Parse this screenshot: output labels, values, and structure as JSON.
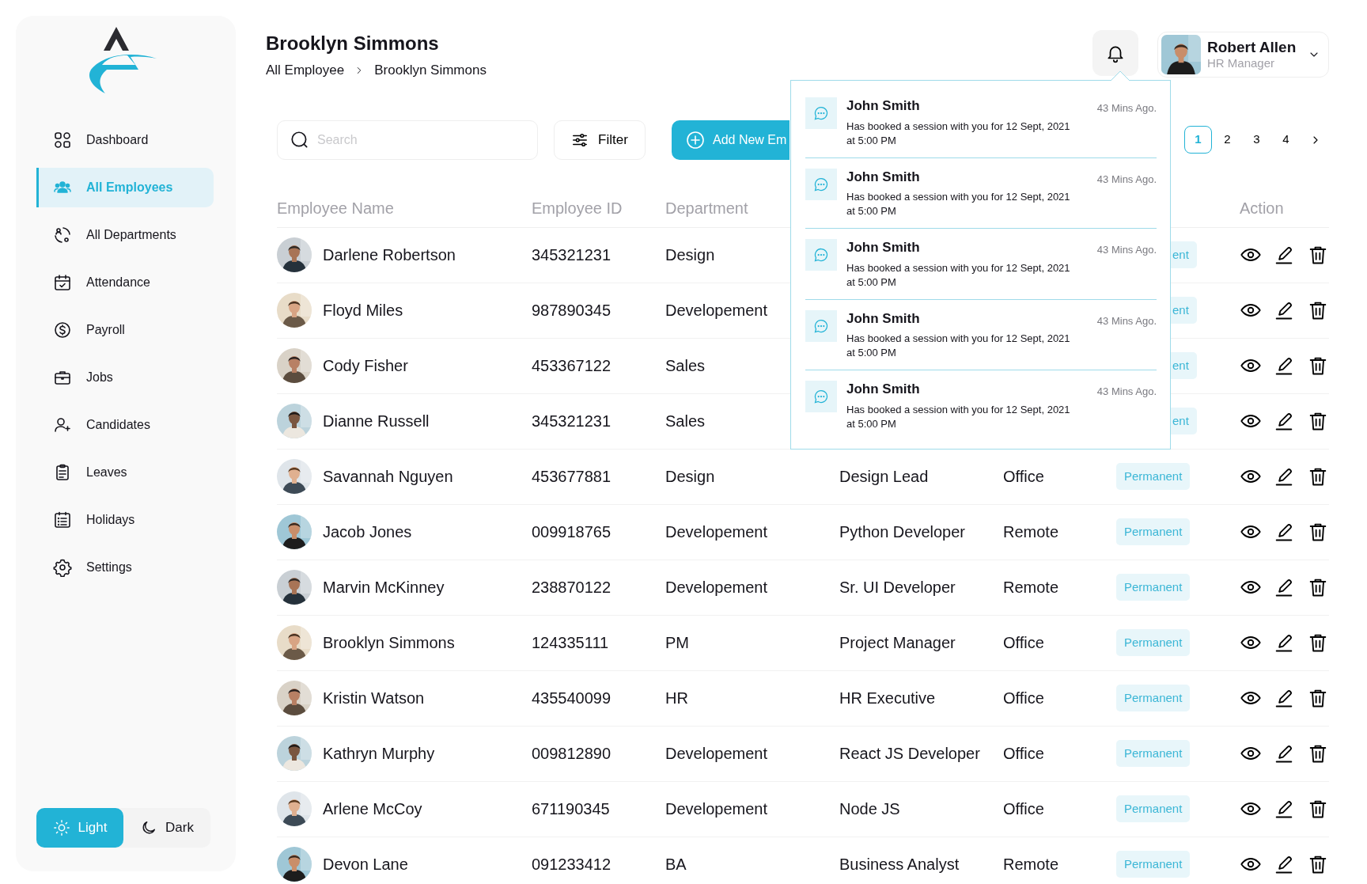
{
  "sidebar": {
    "items": [
      {
        "label": "Dashboard",
        "selected": false
      },
      {
        "label": "All Employees",
        "selected": true
      },
      {
        "label": "All Departments",
        "selected": false
      },
      {
        "label": "Attendance",
        "selected": false
      },
      {
        "label": "Payroll",
        "selected": false
      },
      {
        "label": "Jobs",
        "selected": false
      },
      {
        "label": "Candidates",
        "selected": false
      },
      {
        "label": "Leaves",
        "selected": false
      },
      {
        "label": "Holidays",
        "selected": false
      },
      {
        "label": "Settings",
        "selected": false
      }
    ],
    "theme": [
      {
        "label": "Light",
        "selected": true
      },
      {
        "label": "Dark",
        "selected": false
      }
    ]
  },
  "header": {
    "title": "Brooklyn Simmons",
    "breadcrumb": [
      "All Employee",
      "Brooklyn Simmons"
    ],
    "user": {
      "name": "Robert Allen",
      "role": "HR Manager"
    }
  },
  "toolbar": {
    "search": {
      "placeholder": "Search"
    },
    "filter": "Filter",
    "add_button": "Add New Em",
    "pages": [
      {
        "label": "1",
        "selected": true
      },
      {
        "label": "2",
        "selected": false
      },
      {
        "label": "3",
        "selected": false
      },
      {
        "label": "4",
        "selected": false
      }
    ]
  },
  "table": {
    "columns": {
      "name": "Employee Name",
      "employee_id": "Employee ID",
      "department": "Department",
      "action": "Action"
    },
    "rows": [
      {
        "name": "Darlene Robertson",
        "employee_id": "345321231",
        "department": "Design",
        "status": "ent"
      },
      {
        "name": "Floyd Miles",
        "employee_id": "987890345",
        "department": "Developement",
        "status": "ent"
      },
      {
        "name": "Cody Fisher",
        "employee_id": "453367122",
        "department": "Sales",
        "status": "ent"
      },
      {
        "name": "Dianne Russell",
        "employee_id": "345321231",
        "department": "Sales",
        "status": "ent"
      },
      {
        "name": "Savannah Nguyen",
        "employee_id": "453677881",
        "department": "Design",
        "designation": "Design Lead",
        "type": "Office",
        "status": "Permanent"
      },
      {
        "name": "Jacob Jones",
        "employee_id": "009918765",
        "department": "Developement",
        "designation": "Python Developer",
        "type": "Remote",
        "status": "Permanent"
      },
      {
        "name": "Marvin McKinney",
        "employee_id": "238870122",
        "department": "Developement",
        "designation": "Sr. UI Developer",
        "type": "Remote",
        "status": "Permanent"
      },
      {
        "name": "Brooklyn Simmons",
        "employee_id": "124335111",
        "department": "PM",
        "designation": "Project Manager",
        "type": "Office",
        "status": "Permanent"
      },
      {
        "name": "Kristin Watson",
        "employee_id": "435540099",
        "department": "HR",
        "designation": "HR Executive",
        "type": "Office",
        "status": "Permanent"
      },
      {
        "name": "Kathryn Murphy",
        "employee_id": "009812890",
        "department": "Developement",
        "designation": "React JS Developer",
        "type": "Office",
        "status": "Permanent"
      },
      {
        "name": "Arlene McCoy",
        "employee_id": "671190345",
        "department": "Developement",
        "designation": "Node JS",
        "type": "Office",
        "status": "Permanent"
      },
      {
        "name": "Devon Lane",
        "employee_id": "091233412",
        "department": "BA",
        "designation": "Business Analyst",
        "type": "Remote",
        "status": "Permanent"
      }
    ]
  },
  "notifications": [
    {
      "name": "John Smith",
      "time": "43 Mins Ago.",
      "message": "Has booked a session with you for 12 Sept, 2021 at 5:00 PM"
    },
    {
      "name": "John Smith",
      "time": "43 Mins Ago.",
      "message": "Has booked a session with you for 12 Sept, 2021 at 5:00 PM"
    },
    {
      "name": "John Smith",
      "time": "43 Mins Ago.",
      "message": "Has booked a session with you for 12 Sept, 2021 at 5:00 PM"
    },
    {
      "name": "John Smith",
      "time": "43 Mins Ago.",
      "message": "Has booked a session with you for 12 Sept, 2021 at 5:00 PM"
    },
    {
      "name": "John Smith",
      "time": "43 Mins Ago.",
      "message": "Has booked a session with you for 12 Sept, 2021 at 5:00 PM"
    }
  ]
}
